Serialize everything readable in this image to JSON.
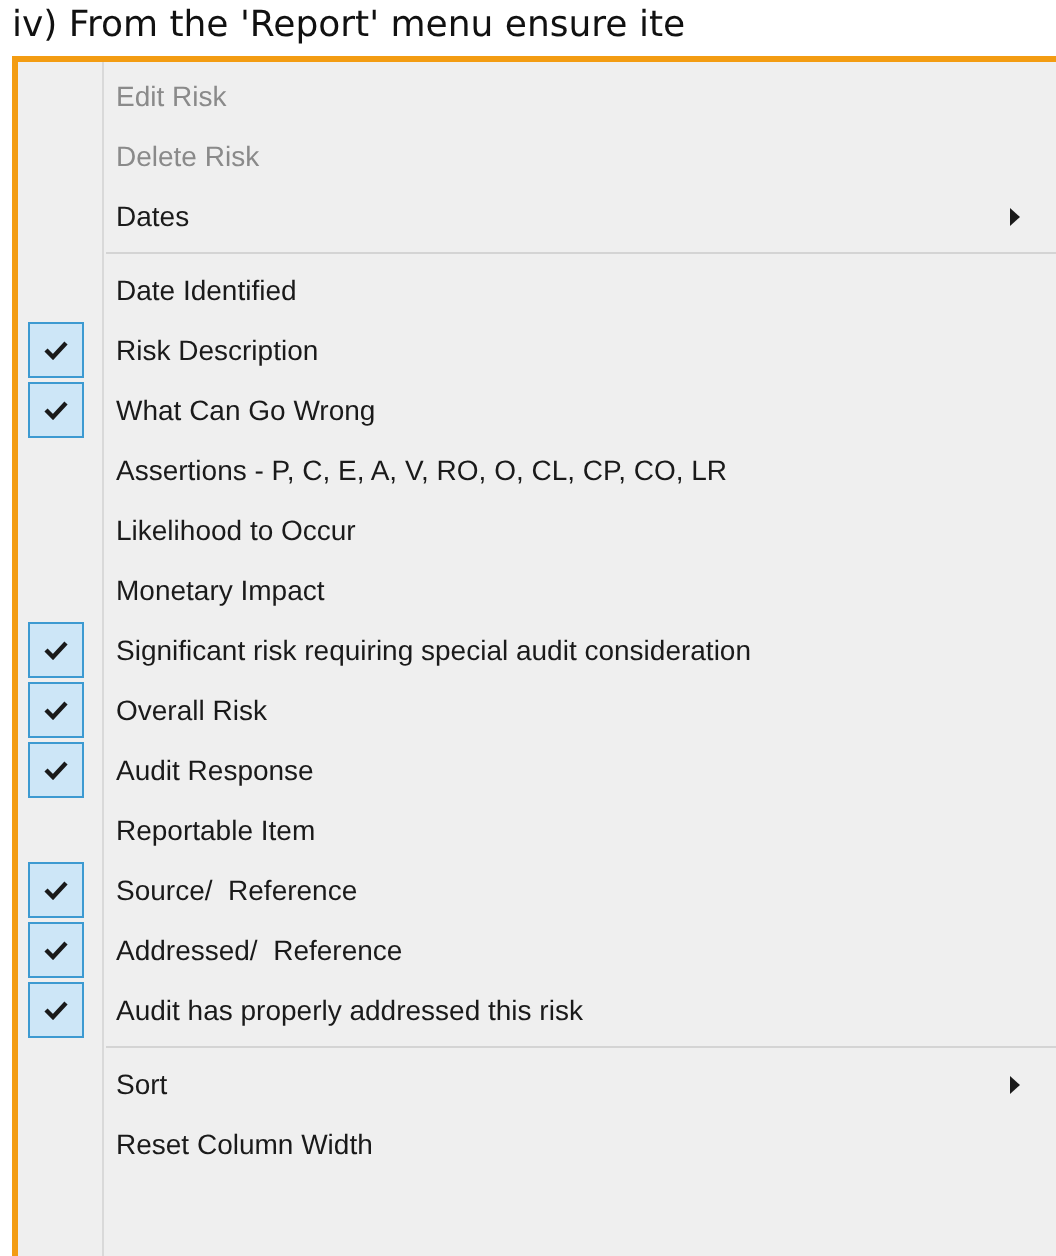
{
  "heading": "iv) From the 'Report' menu ensure ite",
  "menu": {
    "sections": [
      {
        "items": [
          {
            "kind": "command",
            "label": "Edit Risk",
            "disabled": true
          },
          {
            "kind": "command",
            "label": "Delete Risk",
            "disabled": true
          },
          {
            "kind": "submenu",
            "label": "Dates",
            "disabled": false
          }
        ]
      },
      {
        "items": [
          {
            "kind": "toggle",
            "label": "Date Identified",
            "checked": false
          },
          {
            "kind": "toggle",
            "label": "Risk Description",
            "checked": true
          },
          {
            "kind": "toggle",
            "label": "What Can Go Wrong",
            "checked": true
          },
          {
            "kind": "toggle",
            "label": "Assertions - P, C, E, A, V, RO, O, CL, CP, CO, LR",
            "checked": false
          },
          {
            "kind": "toggle",
            "label": "Likelihood to Occur",
            "checked": false
          },
          {
            "kind": "toggle",
            "label": "Monetary Impact",
            "checked": false
          },
          {
            "kind": "toggle",
            "label": "Significant risk requiring special audit consideration",
            "checked": true
          },
          {
            "kind": "toggle",
            "label": "Overall Risk",
            "checked": true
          },
          {
            "kind": "toggle",
            "label": "Audit Response",
            "checked": true
          },
          {
            "kind": "toggle",
            "label": "Reportable Item",
            "checked": false
          },
          {
            "kind": "toggle",
            "label": "Source/  Reference",
            "checked": true
          },
          {
            "kind": "toggle",
            "label": "Addressed/  Reference",
            "checked": true
          },
          {
            "kind": "toggle",
            "label": "Audit has properly addressed this risk",
            "checked": true
          }
        ]
      },
      {
        "items": [
          {
            "kind": "submenu",
            "label": "Sort",
            "disabled": false
          },
          {
            "kind": "command",
            "label": "Reset Column Width",
            "disabled": false
          }
        ]
      }
    ]
  }
}
